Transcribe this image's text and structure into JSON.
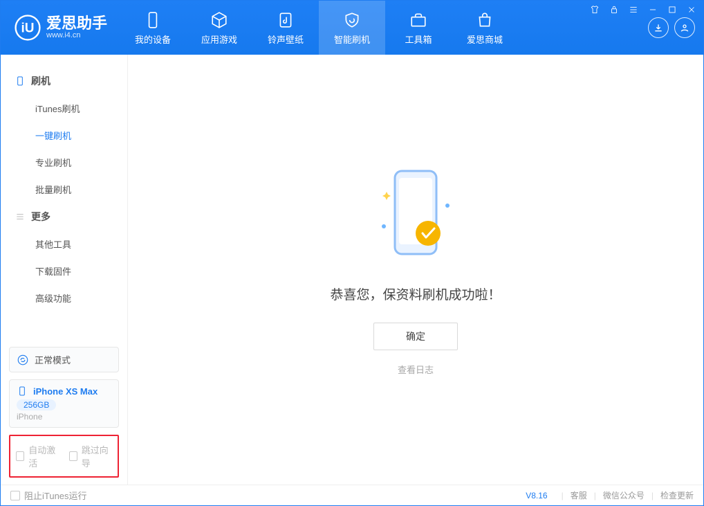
{
  "brand": {
    "title": "爱思助手",
    "subtitle": "www.i4.cn"
  },
  "tabs": [
    {
      "label": "我的设备"
    },
    {
      "label": "应用游戏"
    },
    {
      "label": "铃声壁纸"
    },
    {
      "label": "智能刷机"
    },
    {
      "label": "工具箱"
    },
    {
      "label": "爱思商城"
    }
  ],
  "sidebar": {
    "section1": "刷机",
    "items1": [
      "iTunes刷机",
      "一键刷机",
      "专业刷机",
      "批量刷机"
    ],
    "section2": "更多",
    "items2": [
      "其他工具",
      "下载固件",
      "高级功能"
    ]
  },
  "mode_card": {
    "label": "正常模式"
  },
  "device_card": {
    "name": "iPhone XS Max",
    "storage": "256GB",
    "type": "iPhone"
  },
  "options": {
    "auto_activate": "自动激活",
    "skip_guide": "跳过向导"
  },
  "main": {
    "success_text": "恭喜您，保资料刷机成功啦！",
    "ok_button": "确定",
    "view_log": "查看日志"
  },
  "footer": {
    "block_itunes": "阻止iTunes运行",
    "version": "V8.16",
    "support": "客服",
    "wechat": "微信公众号",
    "update": "检查更新"
  }
}
